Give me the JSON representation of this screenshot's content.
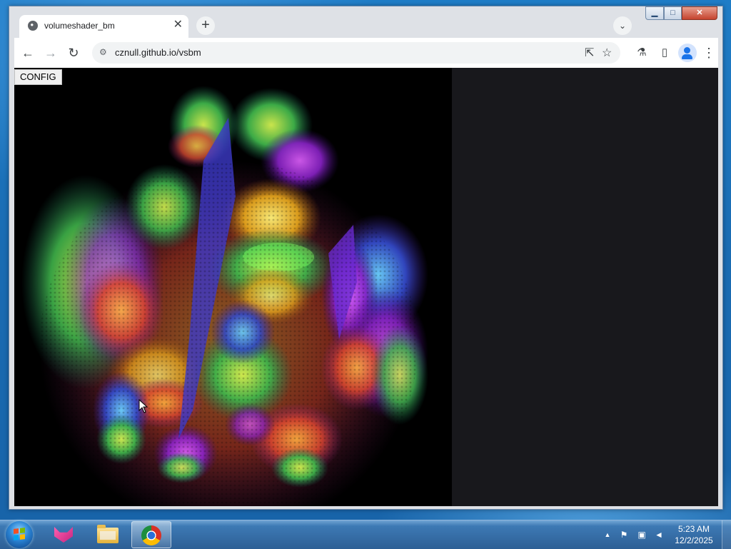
{
  "browser": {
    "tab": {
      "title": "volumeshader_bm",
      "favicon": "globe-icon",
      "close_glyph": "✕"
    },
    "new_tab_glyph": "+",
    "tab_search_glyph": "⌄",
    "window_controls": {
      "minimize": "▁",
      "maximize": "□",
      "close": "✕"
    },
    "nav": {
      "back": "←",
      "forward": "→",
      "reload": "↻"
    },
    "address_bar": {
      "url": "cznull.github.io/vsbm",
      "site_info_icon": "tune-icon"
    },
    "toolbar_icons": {
      "share": "⇱",
      "bookmark": "☆",
      "labs": "⚗",
      "side_panel": "▯",
      "menu": "⋮"
    }
  },
  "page": {
    "config_button": "CONFIG",
    "canvas_background": "#000000",
    "side_panel_color": "#18181c"
  },
  "taskbar": {
    "apps": [
      "fox-app-icon",
      "folder-icon",
      "chrome-icon"
    ],
    "tray": {
      "show_hidden": "▲",
      "time": "5:23 AM",
      "date": "12/2/2025"
    }
  }
}
